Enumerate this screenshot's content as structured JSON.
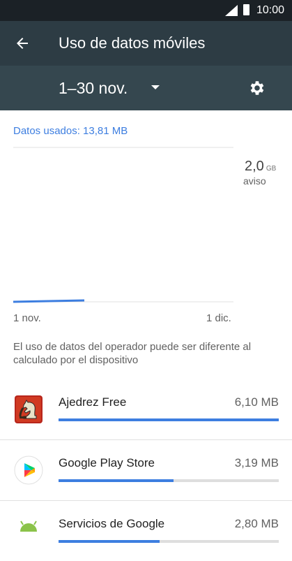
{
  "status_bar": {
    "time": "10:00"
  },
  "app_bar": {
    "title": "Uso de datos móviles",
    "back_icon": "arrow-back-icon"
  },
  "filter": {
    "period": "1–30 nov.",
    "dropdown_icon": "caret-down-icon",
    "settings_icon": "gear-icon"
  },
  "usage": {
    "label": "Datos usados: 13,81 MB"
  },
  "chart": {
    "warning_value": "2,0",
    "warning_unit": "GB",
    "warning_label": "aviso",
    "x_start": "1 nov.",
    "x_end": "1 dic.",
    "accent": "#3d7ee0"
  },
  "note": "El uso de datos del operador puede ser diferente al calculado por el dispositivo",
  "apps": [
    {
      "name": "Ajedrez Free",
      "size": "6,10 MB",
      "fraction": 1.0,
      "icon": "chess-knight-icon"
    },
    {
      "name": "Google Play Store",
      "size": "3,19 MB",
      "fraction": 0.523,
      "icon": "play-store-icon"
    },
    {
      "name": "Servicios de Google",
      "size": "2,80 MB",
      "fraction": 0.46,
      "icon": "android-icon"
    }
  ]
}
